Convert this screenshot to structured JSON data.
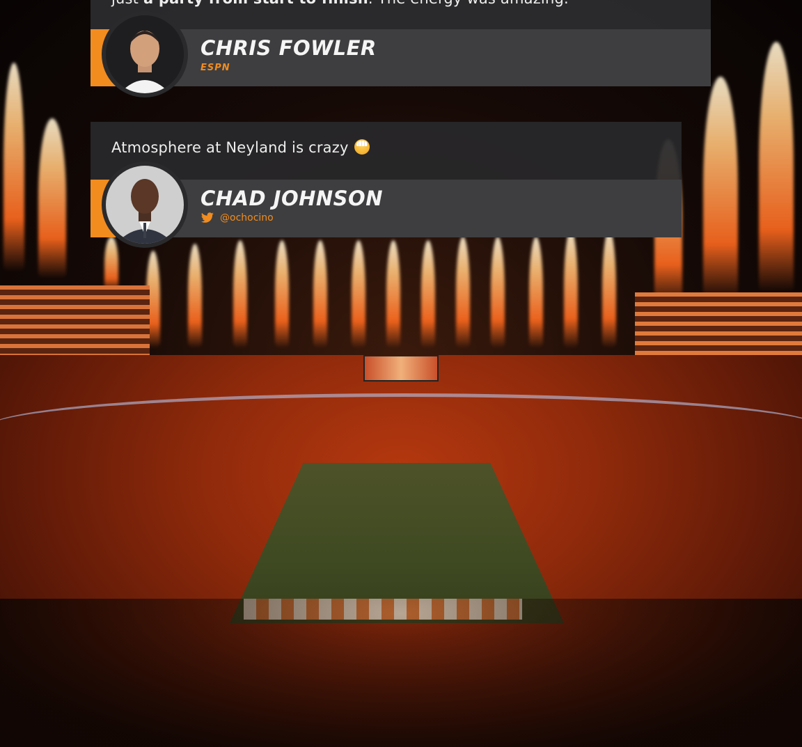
{
  "quotes": [
    {
      "text_prefix": "just ",
      "text_bold": "a party from start to finish",
      "text_suffix": ". The energy was amazing.",
      "author": "CHRIS FOWLER",
      "affiliation": "ESPN"
    },
    {
      "text": "Atmosphere at Neyland is crazy",
      "emoji": "exploding-head-emoji",
      "author": "CHAD JOHNSON",
      "handle": "@ochocino",
      "handle_icon": "twitter-bird-icon"
    }
  ],
  "colors": {
    "accent": "#f28c1e",
    "card": "#2c2c2e",
    "text": "#f5f5f5"
  }
}
